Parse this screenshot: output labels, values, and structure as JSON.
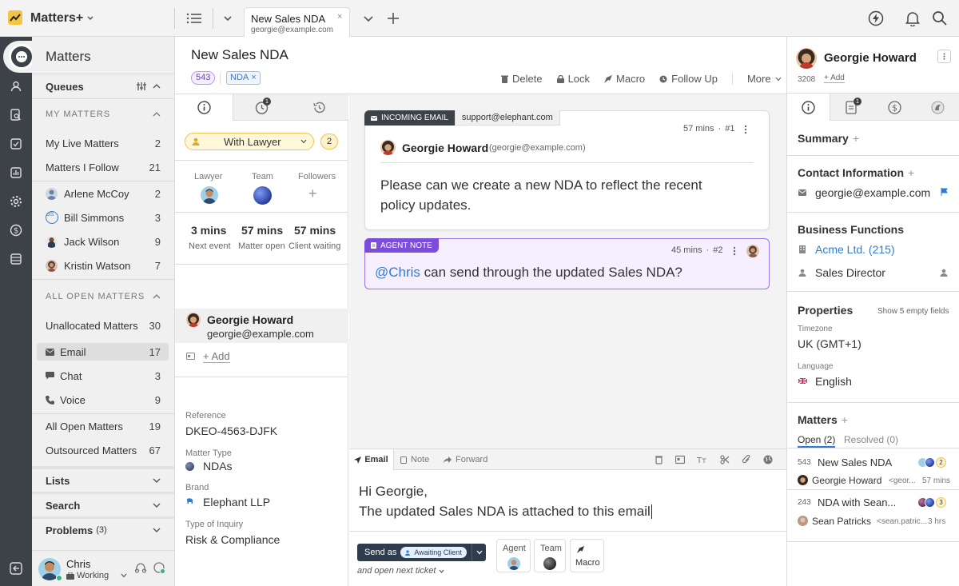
{
  "app": {
    "name": "Matters+"
  },
  "tab": {
    "title": "New Sales NDA",
    "subtitle": "georgie@example.com"
  },
  "colors": {
    "accent": "#2f7cd6",
    "dark_nav": "#3d4148",
    "agent_note": "#7c4ddb",
    "status_yellow": "#f5c542"
  },
  "left_nav": {
    "title": "Matters",
    "queues": "Queues",
    "my_matters_header": "MY MATTERS",
    "my_matters": [
      {
        "label": "My Live Matters",
        "count": "2"
      },
      {
        "label": "Matters I Follow",
        "count": "21"
      }
    ],
    "people": [
      {
        "label": "Arlene McCoy",
        "count": "2"
      },
      {
        "label": "Bill Simmons",
        "count": "3",
        "initials": "BS"
      },
      {
        "label": "Jack Wilson",
        "count": "9"
      },
      {
        "label": "Kristin Watson",
        "count": "7"
      }
    ],
    "all_open_header": "ALL OPEN MATTERS",
    "unallocated": {
      "label": "Unallocated Matters",
      "count": "30"
    },
    "channels": [
      {
        "label": "Email",
        "count": "17"
      },
      {
        "label": "Chat",
        "count": "3"
      },
      {
        "label": "Voice",
        "count": "9"
      }
    ],
    "all_open": {
      "label": "All Open Matters",
      "count": "19"
    },
    "outsourced": {
      "label": "Outsourced Matters",
      "count": "67"
    },
    "lists": "Lists",
    "search": "Search",
    "problems": "Problems",
    "problems_count": "(3)",
    "user": {
      "name": "Chris",
      "status": "Working"
    }
  },
  "matter": {
    "title": "New Sales NDA",
    "id": "543",
    "tag": "NDA",
    "actions": [
      "Delete",
      "Lock",
      "Macro",
      "Follow Up",
      "More"
    ],
    "tab_badge": "1",
    "status": "With Lawyer",
    "status_count": "2",
    "roles": [
      "Lawyer",
      "Team",
      "Followers"
    ],
    "add_symbol": "+",
    "stats": [
      {
        "value": "3 mins",
        "label": "Next event"
      },
      {
        "value": "57 mins",
        "label": "Matter open"
      },
      {
        "value": "57 mins",
        "label": "Client waiting"
      }
    ],
    "contact": {
      "name": "Georgie Howard",
      "email": "georgie@example.com"
    },
    "add_label": "+ Add",
    "fields": [
      {
        "label": "Reference",
        "value": "DKEO-4563-DJFK"
      },
      {
        "label": "Matter Type",
        "value": "NDAs"
      },
      {
        "label": "Brand",
        "value": "Elephant LLP"
      },
      {
        "label": "Type of Inquiry",
        "value": "Risk & Compliance"
      }
    ]
  },
  "thread": {
    "email": {
      "tag": "INCOMING EMAIL",
      "address": "support@elephant.com",
      "time": "57 mins",
      "num": "#1",
      "sender": "Georgie Howard",
      "sender_email": "(georgie@example.com)",
      "body": "Please can we create a new NDA to reflect the recent policy updates."
    },
    "note": {
      "tag": "AGENT NOTE",
      "time": "45 mins",
      "num": "#2",
      "mention": "@Chris",
      "body": " can send through the updated Sales NDA?"
    }
  },
  "composer": {
    "tabs": [
      "Email",
      "Note",
      "Forward"
    ],
    "line1": "Hi Georgie,",
    "line2": "The updated Sales NDA is attached to this email",
    "send_as": "Send as",
    "send_status": "Awaiting Client",
    "and_open": "and open next ticket",
    "agent": "Agent",
    "team": "Team",
    "macro": "Macro"
  },
  "right": {
    "name": "Georgie Howard",
    "id": "3208",
    "add": "+ Add",
    "tab_badge": "1",
    "summary": "Summary",
    "contact_info": "Contact Information",
    "email": "georgie@example.com",
    "business_functions": "Business Functions",
    "company": "Acme Ltd. (215)",
    "role": "Sales Director",
    "properties": "Properties",
    "show_empty": "Show 5 empty fields",
    "timezone_label": "Timezone",
    "timezone": "UK (GMT+1)",
    "language_label": "Language",
    "language": "English",
    "matters": "Matters",
    "open_tab": "Open (2)",
    "resolved_tab": "Resolved (0)",
    "items": [
      {
        "id": "543",
        "title": "New Sales NDA",
        "person": "Georgie Howard",
        "email": "<geor...",
        "time": "57 mins",
        "badge": "2"
      },
      {
        "id": "243",
        "title": "NDA with Sean...",
        "person": "Sean Patricks",
        "email": "<sean.patric...",
        "time": "3 hrs",
        "badge": "3"
      }
    ]
  }
}
